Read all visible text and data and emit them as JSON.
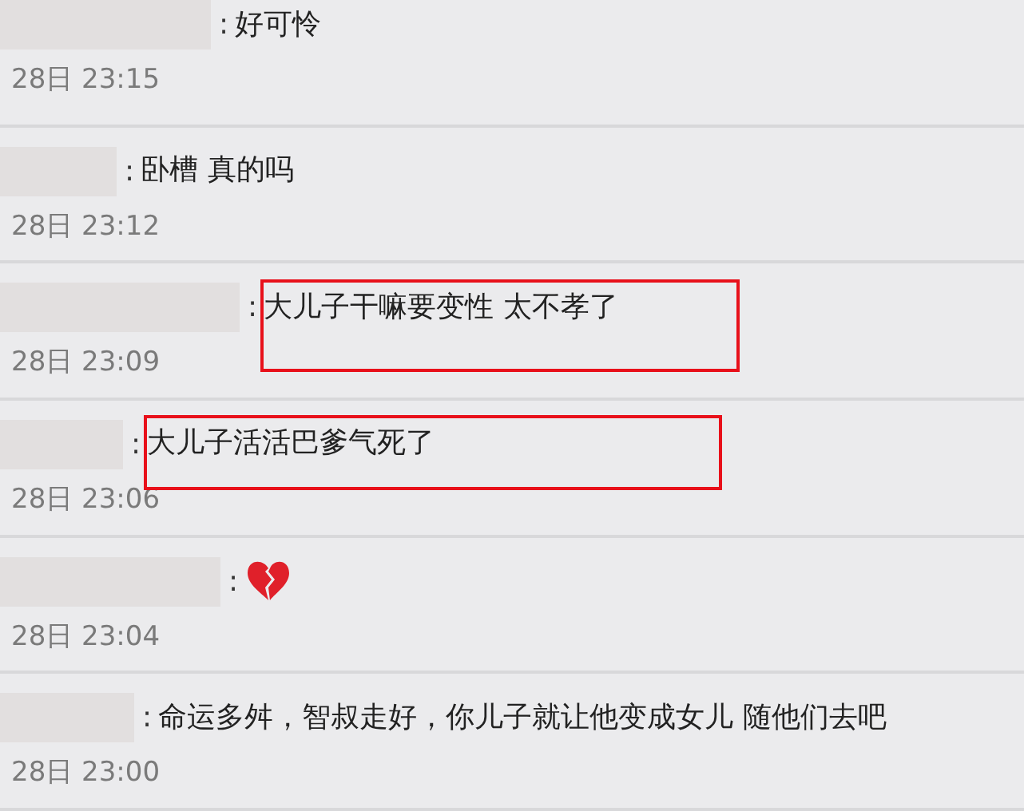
{
  "comments": [
    {
      "kind": "text",
      "text": "好可怜",
      "separator": ":",
      "time": "28日 23:15",
      "highlighted": false
    },
    {
      "kind": "text",
      "text": "卧槽 真的吗",
      "separator": ":",
      "time": "28日 23:12",
      "highlighted": false
    },
    {
      "kind": "text",
      "text": "大儿子干嘛要变性 太不孝了",
      "separator": ":",
      "time": "28日 23:09",
      "highlighted": true
    },
    {
      "kind": "text",
      "text": "大儿子活活巴爹气死了",
      "separator": ":",
      "time": "28日 23:06",
      "highlighted": true
    },
    {
      "kind": "emoji",
      "separator": ":",
      "time": "28日 23:04",
      "highlighted": false
    },
    {
      "kind": "text",
      "text": "命运多舛，智叔走好，你儿子就让他变成女儿 随他们去吧",
      "separator": ":",
      "time": "28日 23:00",
      "highlighted": false
    }
  ]
}
